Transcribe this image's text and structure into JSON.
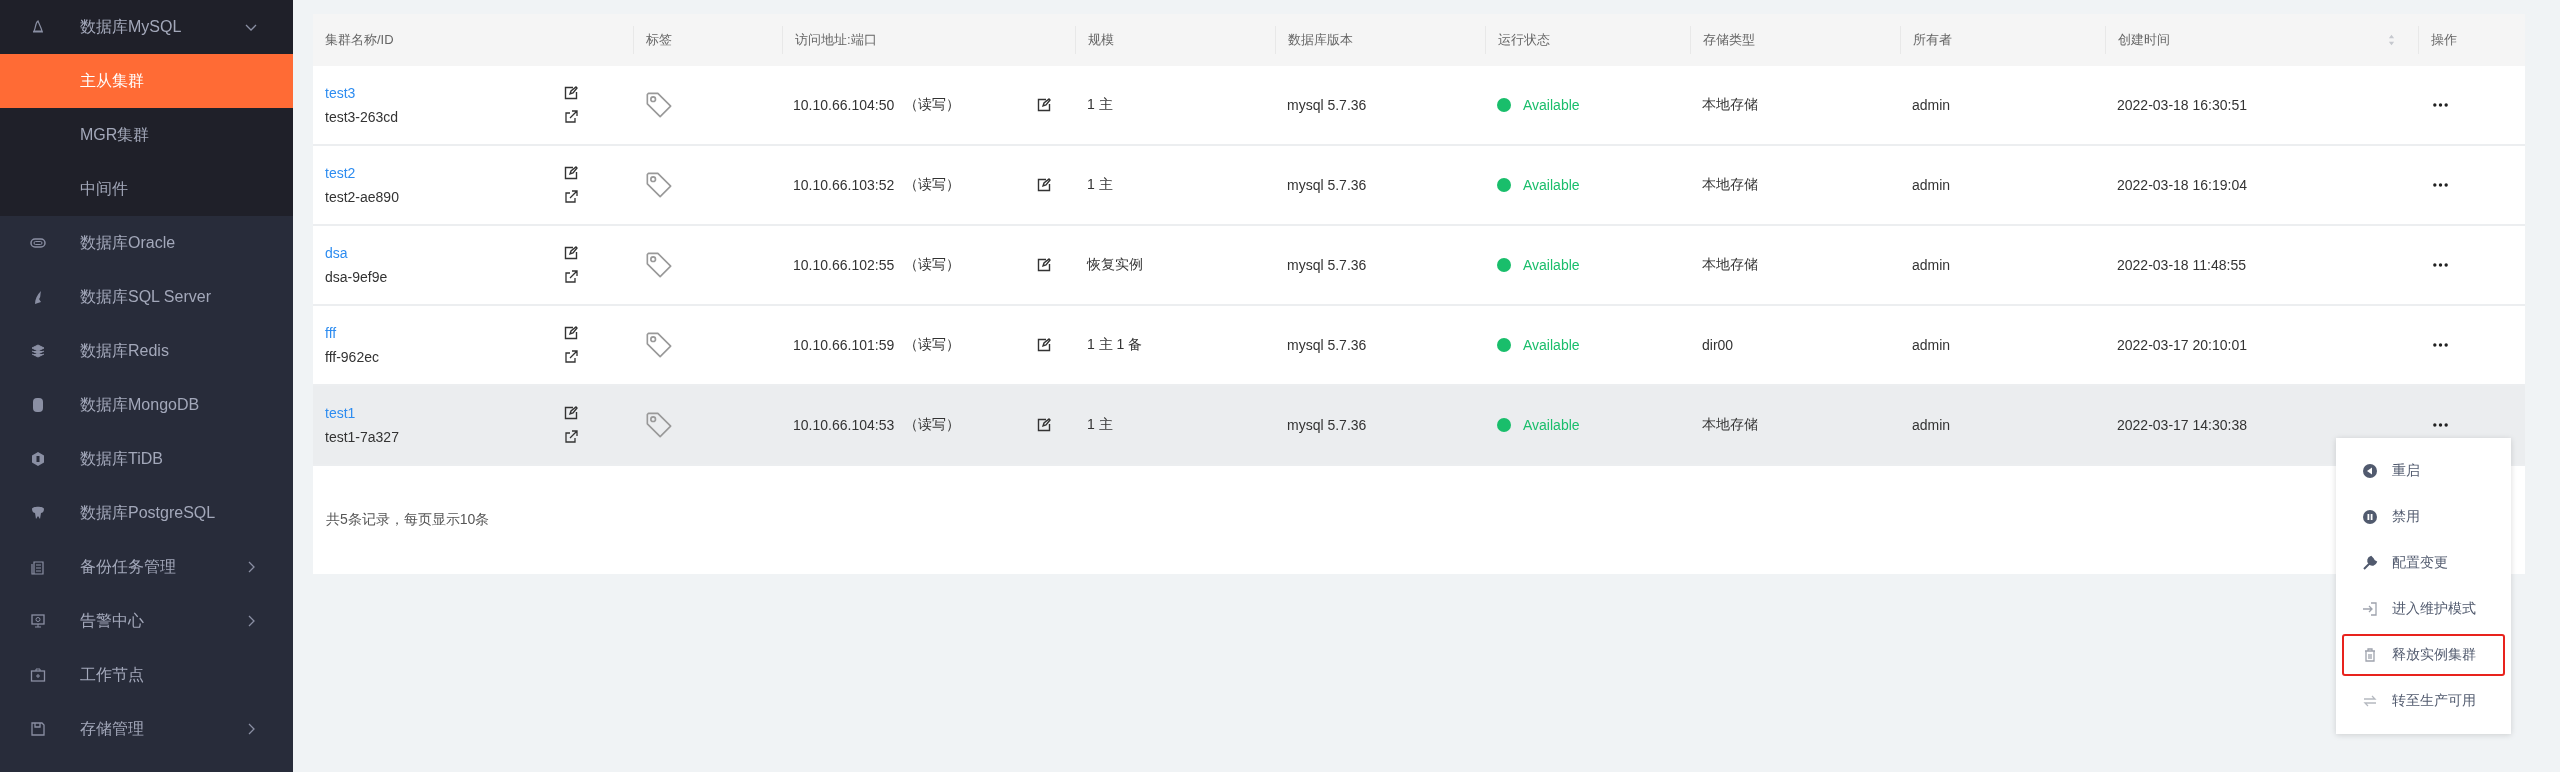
{
  "sidebar": {
    "items": [
      {
        "label": "数据库MySQL",
        "expanded": true,
        "children": [
          {
            "label": "主从集群",
            "selected": true
          },
          {
            "label": "MGR集群",
            "selected": false
          },
          {
            "label": "中间件",
            "selected": false
          }
        ]
      },
      {
        "label": "数据库Oracle",
        "selected": false
      },
      {
        "label": "数据库SQL Server",
        "selected": false
      },
      {
        "label": "数据库Redis",
        "selected": false
      },
      {
        "label": "数据库MongoDB",
        "selected": false
      },
      {
        "label": "数据库TiDB",
        "selected": false
      },
      {
        "label": "数据库PostgreSQL",
        "selected": false
      },
      {
        "label": "备份任务管理",
        "expanded": false
      },
      {
        "label": "告警中心",
        "expanded": false
      },
      {
        "label": "工作节点",
        "selected": false
      },
      {
        "label": "存储管理",
        "expanded": false
      }
    ]
  },
  "table": {
    "columns": [
      "集群名称/ID",
      "标签",
      "访问地址:端口",
      "规模",
      "数据库版本",
      "运行状态",
      "存储类型",
      "所有者",
      "创建时间",
      "操作"
    ],
    "rows": [
      {
        "name": "test3",
        "id": "test3-263cd",
        "address": "10.10.66.104:50",
        "access": "（读写）",
        "scale": "1 主",
        "version": "mysql 5.7.36",
        "status": "Available",
        "storage": "本地存储",
        "owner": "admin",
        "created": "2022-03-18 16:30:51",
        "hovered": false
      },
      {
        "name": "test2",
        "id": "test2-ae890",
        "address": "10.10.66.103:52",
        "access": "（读写）",
        "scale": "1 主",
        "version": "mysql 5.7.36",
        "status": "Available",
        "storage": "本地存储",
        "owner": "admin",
        "created": "2022-03-18 16:19:04",
        "hovered": false
      },
      {
        "name": "dsa",
        "id": "dsa-9ef9e",
        "address": "10.10.66.102:55",
        "access": "（读写）",
        "scale": "恢复实例",
        "version": "mysql 5.7.36",
        "status": "Available",
        "storage": "本地存储",
        "owner": "admin",
        "created": "2022-03-18 11:48:55",
        "hovered": false
      },
      {
        "name": "fff",
        "id": "fff-962ec",
        "address": "10.10.66.101:59",
        "access": "（读写）",
        "scale": "1 主 1 备",
        "version": "mysql 5.7.36",
        "status": "Available",
        "storage": "dir00",
        "owner": "admin",
        "created": "2022-03-17 20:10:01",
        "hovered": false
      },
      {
        "name": "test1",
        "id": "test1-7a327",
        "address": "10.10.66.104:53",
        "access": "（读写）",
        "scale": "1 主",
        "version": "mysql 5.7.36",
        "status": "Available",
        "storage": "本地存储",
        "owner": "admin",
        "created": "2022-03-17 14:30:38",
        "hovered": true
      }
    ],
    "footer": "共5条记录，每页显示10条"
  },
  "action_menu": {
    "items": [
      {
        "label": "重启",
        "highlighted": false
      },
      {
        "label": "禁用",
        "highlighted": false
      },
      {
        "label": "配置变更",
        "highlighted": false
      },
      {
        "label": "进入维护模式",
        "highlighted": false
      },
      {
        "label": "释放实例集群",
        "highlighted": true
      },
      {
        "label": "转至生产可用",
        "highlighted": false
      }
    ]
  }
}
